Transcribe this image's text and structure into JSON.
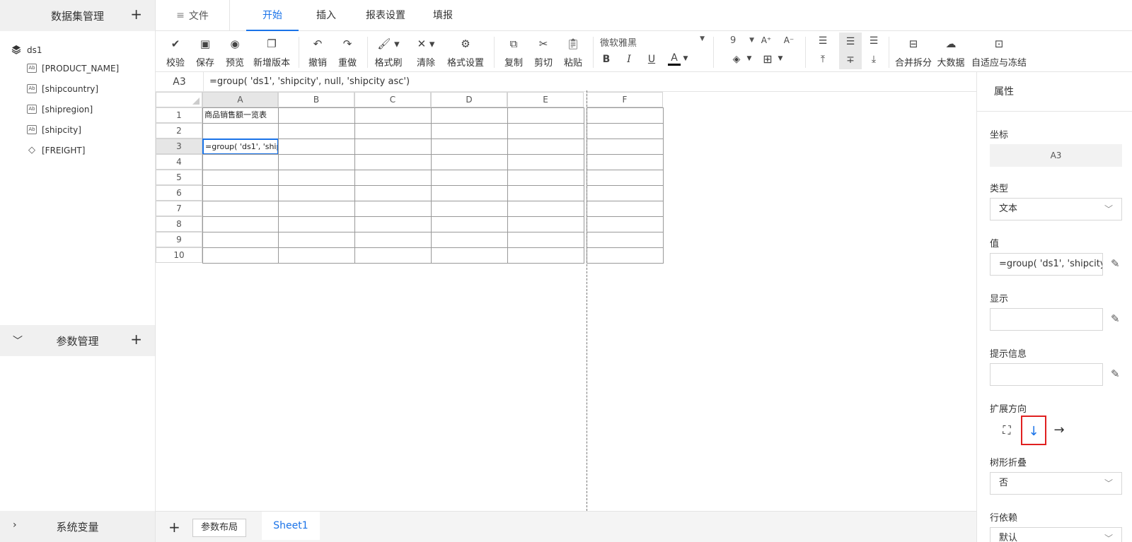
{
  "sidebar": {
    "dataset_title": "数据集管理",
    "add": "+",
    "dataset": "ds1",
    "fields": [
      {
        "label": "[PRODUCT_NAME]",
        "icon": "text-field-icon"
      },
      {
        "label": "[shipcountry]",
        "icon": "text-field-icon"
      },
      {
        "label": "[shipregion]",
        "icon": "text-field-icon"
      },
      {
        "label": "[shipcity]",
        "icon": "text-field-icon"
      },
      {
        "label": "[FREIGHT]",
        "icon": "numeric-field-icon"
      }
    ],
    "param_title": "参数管理",
    "sys_title": "系统变量"
  },
  "topbar": {
    "file": "文件",
    "tabs": [
      "开始",
      "插入",
      "报表设置",
      "填报"
    ],
    "active_tab": "开始"
  },
  "toolbar": {
    "validate": "校验",
    "save": "保存",
    "preview": "预览",
    "new_version": "新增版本",
    "undo": "撤销",
    "redo": "重做",
    "format_painter": "格式刷",
    "clear": "清除",
    "format_settings": "格式设置",
    "copy": "复制",
    "cut": "剪切",
    "paste": "粘贴",
    "font": "微软雅黑",
    "font_size": "9",
    "merge_split": "合并拆分",
    "big_data": "大数据",
    "adaptive_freeze": "自适应与冻结"
  },
  "formula_bar": {
    "cell_ref": "A3",
    "formula": "=group( 'ds1', 'shipcity', null, 'shipcity asc')"
  },
  "grid": {
    "columns": [
      "A",
      "B",
      "C",
      "D",
      "E",
      "F"
    ],
    "rows": [
      "1",
      "2",
      "3",
      "4",
      "5",
      "6",
      "7",
      "8",
      "9",
      "10"
    ],
    "selected_column": "A",
    "selected_row": "3",
    "cell_a1": "商品销售额一览表",
    "cell_a3": "=group( 'ds1', 'shipcity', null, 'shipcity asc')"
  },
  "bottom": {
    "add": "+",
    "param_layout": "参数布局",
    "sheet": "Sheet1"
  },
  "props": {
    "title": "属性",
    "coord_label": "坐标",
    "coord_value": "A3",
    "type_label": "类型",
    "type_value": "文本",
    "value_label": "值",
    "value_value": "=group( 'ds1', 'shipcity', null, 'shipcity asc')",
    "display_label": "显示",
    "display_value": "",
    "tooltip_label": "提示信息",
    "tooltip_value": "",
    "expand_label": "扩展方向",
    "expand_selected": "down",
    "tree_fold_label": "树形折叠",
    "tree_fold_value": "否",
    "row_dep_label": "行依赖",
    "row_dep_value": "默认"
  },
  "colors": {
    "accent": "#1a73e8",
    "highlight_box": "#e02020"
  }
}
